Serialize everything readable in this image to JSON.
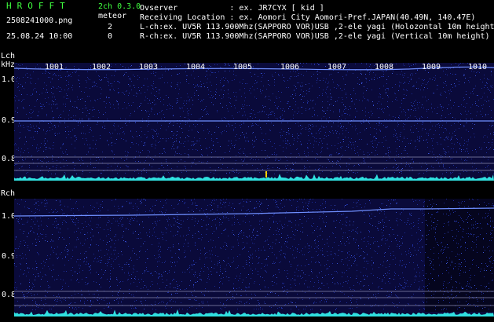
{
  "header": {
    "title": "HROFFT",
    "version": "2ch 0.3.0",
    "filename": "2508241000.png",
    "meteor_label": "meteor",
    "datetime": "25.08.24 10:00",
    "count_l": "2",
    "count_r": "0"
  },
  "info": {
    "observer": "Ovserver           : ex. JR7CYX [ kid ]",
    "location": "Receiving Location : ex. Aomori City Aomori-Pref.JAPAN(40.49N, 140.47E)",
    "lch": "L-ch:ex. UV5R 113.900Mhz(SAPPORO VOR)USB ,2-ele yagi (Holozontal 10m height)",
    "rch": "R-ch:ex. UV5R 113.900Mhz(SAPPORO VOR)USB ,2-ele yagi (Vertical 10m height)"
  },
  "lch_panel": {
    "label": "Lch",
    "unit": "kHz",
    "ticks": [
      "1.0",
      "0.9",
      "0.8"
    ]
  },
  "rch_panel": {
    "label": "Rch",
    "ticks": [
      "1.0",
      "0.9",
      "0.8"
    ]
  },
  "minutes": [
    "1001",
    "1002",
    "1003",
    "1004",
    "1005",
    "1006",
    "1007",
    "1008",
    "1009",
    "1010"
  ],
  "colors": {
    "background": "#000000",
    "spectrogram_bg": "#0a0a3a",
    "noise": "#1e2e9a",
    "carrier": "#6f8fff",
    "baseline": "#30e0e0",
    "header_green": "#3fff3f",
    "meteor_mark": "#ffd000"
  }
}
